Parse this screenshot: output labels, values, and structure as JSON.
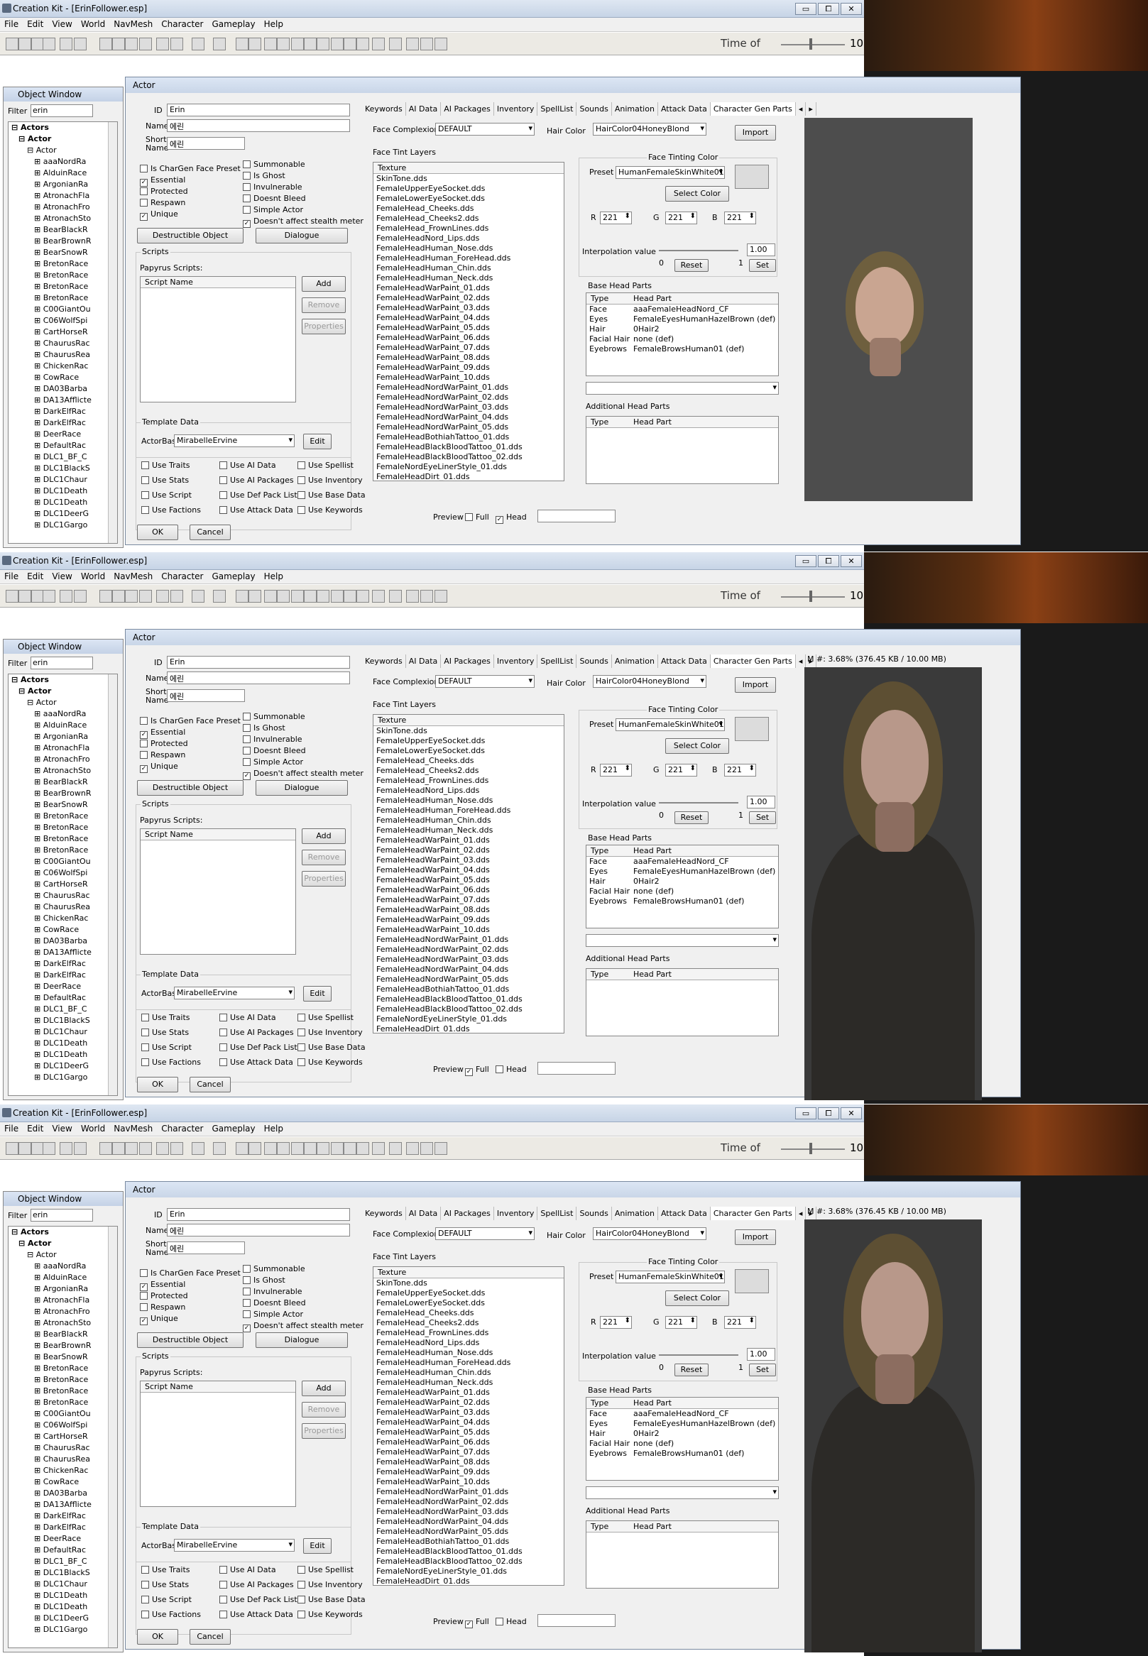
{
  "titlebar": {
    "title": "Creation Kit - [ErinFollower.esp]",
    "min": "▭",
    "max": "⧠",
    "close": "✕"
  },
  "menu": [
    "File",
    "Edit",
    "View",
    "World",
    "NavMesh",
    "Character",
    "Gameplay",
    "Help"
  ],
  "toolbar": {
    "time_label": "Time of",
    "time_value": "10"
  },
  "object_window": {
    "title": "Object Window",
    "filter_label": "Filter",
    "filter_value": "erin",
    "tree": [
      "Actors",
      "Actor",
      "Actor",
      "aaaNordRa",
      "AlduinRace",
      "ArgonianRa",
      "AtronachFla",
      "AtronachFro",
      "AtronachSto",
      "BearBlackR",
      "BearBrownR",
      "BearSnowR",
      "BretonRace",
      "BretonRace",
      "BretonRace",
      "BretonRace",
      "C00GiantOu",
      "C06WolfSpi",
      "CartHorseR",
      "ChaurusRac",
      "ChaurusRea",
      "ChickenRac",
      "CowRace",
      "DA03Barba",
      "DA13Afflicte",
      "DarkElfRac",
      "DarkElfRac",
      "DeerRace",
      "DefaultRac",
      "DLC1_BF_C",
      "DLC1BlackS",
      "DLC1Chaur",
      "DLC1Death",
      "DLC1Death",
      "DLC1DeerG",
      "DLC1Gargo"
    ]
  },
  "actor": {
    "title": "Actor",
    "id_label": "ID",
    "id": "Erin",
    "name_label": "Name",
    "name": "에린",
    "short_label": "Short Name",
    "short": "에린",
    "flags_left": [
      "Is CharGen Face Preset",
      "Essential",
      "Protected",
      "Respawn",
      "Unique"
    ],
    "flags_left_checked": [
      " ",
      "✓",
      " ",
      " ",
      "✓"
    ],
    "flags_right": [
      "Summonable",
      "Is Ghost",
      "Invulnerable",
      "Doesnt Bleed",
      "Simple Actor",
      "Doesn't affect stealth meter"
    ],
    "flags_right_checked": [
      " ",
      " ",
      " ",
      " ",
      " ",
      "✓"
    ],
    "destructible": "Destructible Object",
    "dialogue": "Dialogue",
    "scripts_group": "Scripts",
    "papyrus": "Papyrus Scripts:",
    "script_name": "Script Name",
    "add": "Add",
    "remove": "Remove",
    "properties": "Properties",
    "template_group": "Template Data",
    "actorbase_label": "ActorBase",
    "actorbase": "MirabelleErvine",
    "edit": "Edit",
    "use_flags": [
      "Use Traits",
      "Use AI Data",
      "Use Spellist",
      "Use Stats",
      "Use AI Packages",
      "Use Inventory",
      "Use Script",
      "Use Def Pack List",
      "Use Base Data",
      "Use Factions",
      "Use Attack Data",
      "Use Keywords"
    ],
    "ok": "OK",
    "cancel": "Cancel",
    "tabs": [
      "Keywords",
      "AI Data",
      "AI Packages",
      "Inventory",
      "SpellList",
      "Sounds",
      "Animation",
      "Attack Data",
      "Character Gen Parts",
      "◂",
      "▸"
    ],
    "face_complexion_label": "Face Complexion",
    "face_complexion": "DEFAULT",
    "hair_color_label": "Hair Color",
    "hair_color": "HairColor04HoneyBlond",
    "import": "Import",
    "face_tint_layers": "Face Tint Layers",
    "texture_header": "Texture",
    "textures": [
      "SkinTone.dds",
      "FemaleUpperEyeSocket.dds",
      "FemaleLowerEyeSocket.dds",
      "FemaleHead_Cheeks.dds",
      "FemaleHead_Cheeks2.dds",
      "FemaleHead_FrownLines.dds",
      "FemaleHeadNord_Lips.dds",
      "FemaleHeadHuman_Nose.dds",
      "FemaleHeadHuman_ForeHead.dds",
      "FemaleHeadHuman_Chin.dds",
      "FemaleHeadHuman_Neck.dds",
      "FemaleHeadWarPaint_01.dds",
      "FemaleHeadWarPaint_02.dds",
      "FemaleHeadWarPaint_03.dds",
      "FemaleHeadWarPaint_04.dds",
      "FemaleHeadWarPaint_05.dds",
      "FemaleHeadWarPaint_06.dds",
      "FemaleHeadWarPaint_07.dds",
      "FemaleHeadWarPaint_08.dds",
      "FemaleHeadWarPaint_09.dds",
      "FemaleHeadWarPaint_10.dds",
      "FemaleHeadNordWarPaint_01.dds",
      "FemaleHeadNordWarPaint_02.dds",
      "FemaleHeadNordWarPaint_03.dds",
      "FemaleHeadNordWarPaint_04.dds",
      "FemaleHeadNordWarPaint_05.dds",
      "FemaleHeadBothiahTattoo_01.dds",
      "FemaleHeadBlackBloodTattoo_01.dds",
      "FemaleHeadBlackBloodTattoo_02.dds",
      "FemaleNordEyeLinerStyle_01.dds",
      "FemaleHeadDirt_01.dds"
    ],
    "face_tinting": "Face Tinting Color",
    "preset_label": "Preset",
    "preset": "HumanFemaleSkinWhite01",
    "select_color": "Select Color",
    "r_label": "R",
    "r": "221",
    "g_label": "G",
    "g": "221",
    "b_label": "B",
    "b": "221",
    "interp_label": "Interpolation value",
    "interp": "1.00",
    "zero": "0",
    "one": "1",
    "reset": "Reset",
    "set": "Set",
    "base_head_parts": "Base Head Parts",
    "type_header": "Type",
    "headpart_header": "Head Part",
    "head_parts": [
      [
        "Face",
        "aaaFemaleHeadNord_CF"
      ],
      [
        "Eyes",
        "FemaleEyesHumanHazelBrown (def)"
      ],
      [
        "Hair",
        "0Hair2"
      ],
      [
        "Facial Hair",
        "none (def)"
      ],
      [
        "Eyebrows",
        "FemaleBrowsHuman01 (def)"
      ]
    ],
    "additional_head_parts": "Additional Head Parts",
    "preview_label": "Preview",
    "full": "Full",
    "head": "Head",
    "mem": "M #: 3.68% (376.45 KB / 10.00 MB)"
  },
  "panels": [
    {
      "preview_full": " ",
      "preview_head": "✓",
      "show_mem": false,
      "mode": "head"
    },
    {
      "preview_full": "✓",
      "preview_head": " ",
      "show_mem": true,
      "mode": "full"
    },
    {
      "preview_full": "✓",
      "preview_head": " ",
      "show_mem": true,
      "mode": "full2"
    }
  ]
}
